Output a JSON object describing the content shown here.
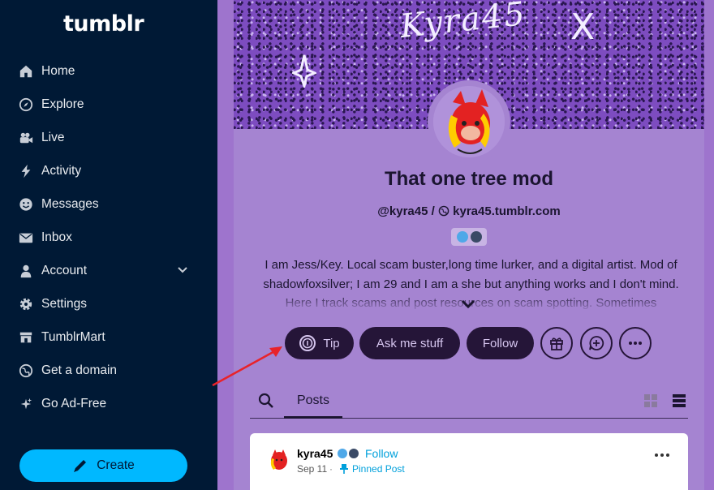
{
  "sidebar": {
    "logo": "tumblr",
    "items": [
      {
        "label": "Home",
        "icon": "home-icon"
      },
      {
        "label": "Explore",
        "icon": "compass-icon"
      },
      {
        "label": "Live",
        "icon": "video-camera-icon"
      },
      {
        "label": "Activity",
        "icon": "lightning-icon"
      },
      {
        "label": "Messages",
        "icon": "smiley-icon"
      },
      {
        "label": "Inbox",
        "icon": "envelope-icon"
      },
      {
        "label": "Account",
        "icon": "person-icon"
      },
      {
        "label": "Settings",
        "icon": "gear-icon"
      },
      {
        "label": "TumblrMart",
        "icon": "shop-icon"
      },
      {
        "label": "Get a domain",
        "icon": "globe-icon"
      },
      {
        "label": "Go Ad-Free",
        "icon": "sparkle-icon"
      }
    ],
    "create_label": "Create"
  },
  "blog": {
    "header_text": "Kyra45",
    "header_mark": "X",
    "title": "That one tree mod",
    "handle": "@kyra45",
    "separator": "/",
    "domain": "kyra45.tumblr.com",
    "description": "I am Jess/Key. Local scam buster,long time lurker, and a digital artist. Mod of shadowfoxsilver; I am 29 and I am a she but anything works and I don't mind. Here I track scams and post resources on scam spotting. Sometimes",
    "actions": {
      "tip": "Tip",
      "ask": "Ask me stuff",
      "follow": "Follow"
    }
  },
  "tabs": {
    "posts": "Posts"
  },
  "post": {
    "author": "kyra45",
    "follow": "Follow",
    "date": "Sep 11",
    "dot": "·",
    "pinned": "Pinned Post"
  },
  "colors": {
    "sidebar_bg": "#001935",
    "create_button": "#00b8ff",
    "blog_bg": "#a584d1",
    "pill_bg": "#251538",
    "link": "#00a0db",
    "arrow": "#e8232a"
  }
}
